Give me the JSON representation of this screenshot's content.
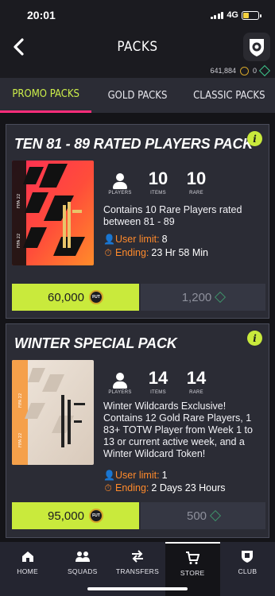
{
  "status": {
    "time": "20:01",
    "network": "4G"
  },
  "header": {
    "title": "PACKS"
  },
  "currency": {
    "coins": "641,884",
    "points": "0"
  },
  "tabs": [
    {
      "label": "PROMO PACKS",
      "active": true
    },
    {
      "label": "GOLD PACKS",
      "active": false
    },
    {
      "label": "CLASSIC PACKS",
      "active": false
    }
  ],
  "packs": [
    {
      "title": "TEN 81 - 89 RATED PLAYERS PACK",
      "info_icon": "i",
      "players_label": "PLAYERS",
      "items": "10",
      "items_label": "ITEMS",
      "rare": "10",
      "rare_label": "RARE",
      "description": "Contains 10 Rare Players rated between 81 - 89",
      "limit_label": "User limit:",
      "limit_value": "8",
      "ending_label": "Ending:",
      "ending_value": "23 Hr 58 Min",
      "price_coins": "60,000",
      "price_points": "1,200"
    },
    {
      "title": "WINTER SPECIAL PACK",
      "info_icon": "i",
      "players_label": "PLAYERS",
      "items": "14",
      "items_label": "ITEMS",
      "rare": "14",
      "rare_label": "RARE",
      "description": "Winter Wildcards Exclusive! Contains 12 Gold Rare Players, 1 83+ TOTW Player from Week 1 to 13 or current active week, and a Winter Wildcard Token!",
      "limit_label": "User limit:",
      "limit_value": "1",
      "ending_label": "Ending:",
      "ending_value": "2 Days 23 Hours",
      "price_coins": "95,000",
      "price_points": "500"
    }
  ],
  "fut_coin_label": "FUT",
  "nav": [
    {
      "label": "HOME",
      "icon": "home-icon",
      "active": false
    },
    {
      "label": "SQUADS",
      "icon": "squads-icon",
      "active": false
    },
    {
      "label": "TRANSFERS",
      "icon": "transfers-icon",
      "active": false
    },
    {
      "label": "STORE",
      "icon": "cart-icon",
      "active": true
    },
    {
      "label": "CLUB",
      "icon": "club-icon",
      "active": false
    }
  ],
  "colors": {
    "accent": "#c9ea3c",
    "tab_underline": "#ff2d7a",
    "meta": "#ff8a2b",
    "card": "#2b2c35"
  }
}
